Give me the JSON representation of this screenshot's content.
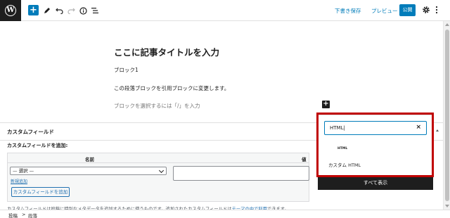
{
  "topbar": {
    "logo_letter": "W",
    "add_block_label": "+",
    "save_draft_label": "下書き保存",
    "preview_label": "プレビュー",
    "publish_label": "公開",
    "icons": [
      "wordpress-logo-icon",
      "plus-icon",
      "pen-icon",
      "undo-icon",
      "redo-icon",
      "info-icon",
      "list-view-icon",
      "gear-icon",
      "more-vertical-icon"
    ]
  },
  "editor": {
    "title": "ここに記事タイトルを入力",
    "paragraphs": [
      "ブロック1",
      "この段落ブロックを引用ブロックに変更します。"
    ],
    "placeholder": "ブロックを選択するには「/」を入力",
    "inserter_label": "+"
  },
  "inserter": {
    "search_value": "HTML|",
    "clear_label": "×",
    "result_icon_text": "HTML",
    "result_label": "カスタム HTML",
    "browse_all_label": "すべて表示"
  },
  "metabox": {
    "title": "カスタムフィールド",
    "add_new_label": "カスタムフィールドを追加:",
    "column_name": "名前",
    "column_value": "値",
    "select_value": "— 選択 —",
    "enter_new_label": "新規追加",
    "add_button_label": "カスタムフィールドを追加",
    "help_text": "カスタムフィールドは投稿に特別なメタデータを追加するために使うものです。追加されたカスタムフィールドは",
    "help_link": "テーマの中で利用",
    "help_suffix": "できます。"
  },
  "footer": {
    "crumbs": [
      "投稿",
      "段落"
    ],
    "separator": ">"
  },
  "colors": {
    "accent": "#007cba",
    "highlight": "#c00000",
    "dark": "#1e1e1e"
  }
}
